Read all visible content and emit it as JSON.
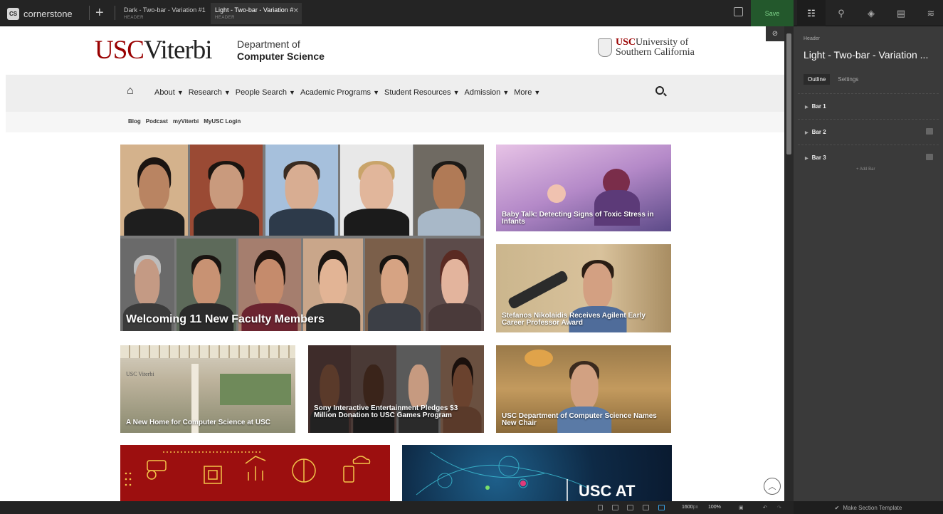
{
  "app": {
    "name": "cornerstone",
    "logo_mark": "CS"
  },
  "tabs": [
    {
      "title": "Dark - Two-bar - Variation #1",
      "type": "HEADER"
    },
    {
      "title": "Light - Two-bar - Variation #",
      "type": "HEADER"
    }
  ],
  "toolbar": {
    "save_label": "Save"
  },
  "site": {
    "brand_usc": "USC",
    "brand_viterbi": "Viterbi",
    "dept_line1": "Department of",
    "dept_line2": "Computer Science",
    "univ_usc": "USC",
    "univ_rest1": "University of",
    "univ_rest2": "Southern California",
    "nav": [
      "About",
      "Research",
      "People Search",
      "Academic Programs",
      "Student Resources",
      "Admission",
      "More"
    ],
    "subnav": [
      "Blog",
      "Podcast",
      "myViterbi",
      "MyUSC Login"
    ]
  },
  "tiles": {
    "faculty": "Welcoming 11 New Faculty Members",
    "baby": "Baby Talk: Detecting Signs of Toxic Stress in Infants",
    "stefanos": "Stefanos Nikolaidis Receives Agilent Early Career Professor Award",
    "home": "A New Home for Computer Science at USC",
    "sony": "Sony Interactive Entertainment Pledges $3 Million Donation to USC Games Program",
    "chair": "USC Department of Computer Science Names New Chair",
    "uscat": "USC AT",
    "building_sign": "USC Viterbi"
  },
  "panel": {
    "section_label": "Header",
    "title": "Light - Two-bar - Variation ...",
    "tabs": [
      "Outline",
      "Settings"
    ],
    "bars": [
      "Bar 1",
      "Bar 2",
      "Bar 3"
    ],
    "add_bar": "+ Add Bar",
    "make_template": "Make Section Template"
  },
  "status": {
    "width_value": "1600",
    "width_unit": "px",
    "zoom": "100%"
  },
  "colors": {
    "usc_red": "#990000",
    "save_green": "#23582c",
    "panel_bg": "#3a3a3a"
  }
}
